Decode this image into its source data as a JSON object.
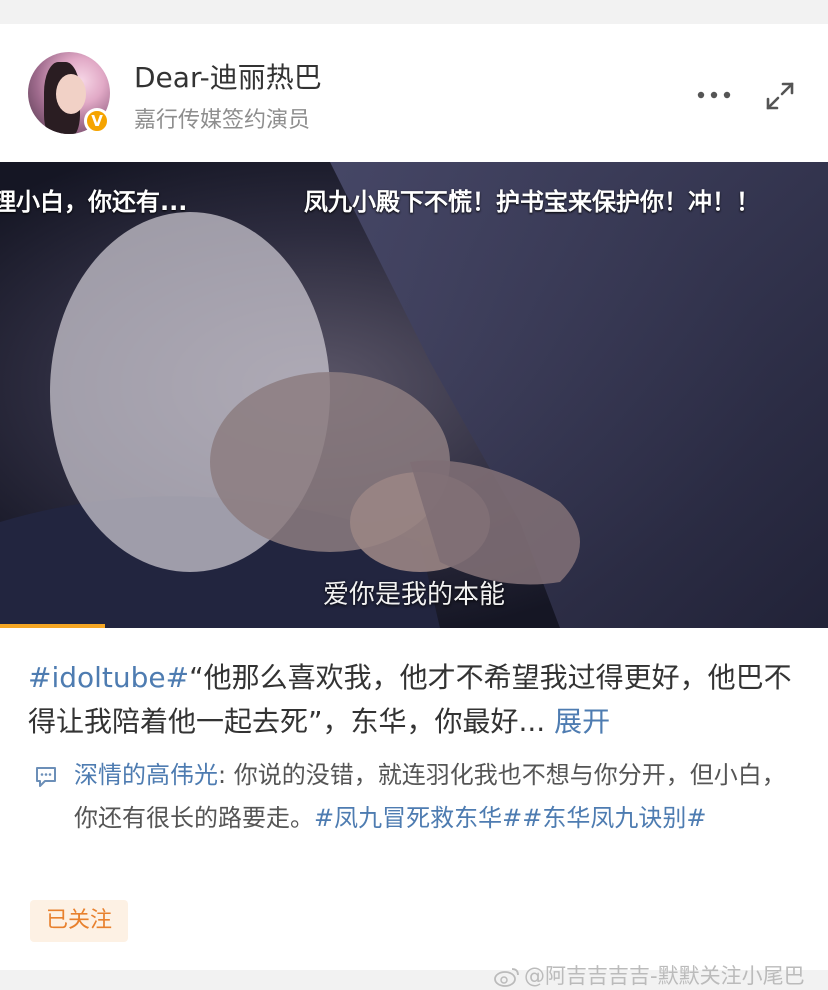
{
  "post": {
    "author_name": "Dear-迪丽热巴",
    "author_subtitle": "嘉行传媒签约演员",
    "verified_badge": "V",
    "video": {
      "danmu_left": "理小白，你还有...",
      "danmu_right": "凤九小殿下不慌！护书宝来保护你！冲！！",
      "subtitle": "爱你是我的本能",
      "progress_fraction": 0.127
    },
    "text_hashtag": "#idoltube#",
    "text_body": "“他那么喜欢我，他才不希望我过得更好，他巴不得让我陪着他一起去死”，东华，你最好...",
    "expand_label": "展开",
    "comment": {
      "commenter": "深情的高伟光",
      "separator": ": ",
      "text": "你说的没错，就连羽化我也不想与你分开，但小白，你还有很长的路要走。",
      "hashtags": "#凤九冒死救东华##东华凤九诀别#"
    },
    "follow_label": "已关注"
  },
  "watermark": "@阿吉吉吉吉-默默关注小尾巴",
  "icons": {
    "more": "more-horizontal-icon",
    "expand": "fullscreen-expand-icon",
    "comment": "comment-bubble-icon",
    "weibo": "weibo-logo-icon"
  },
  "colors": {
    "link": "#4e7cb1",
    "progress": "#f5a623",
    "follow_bg": "#fdf1e4",
    "follow_text": "#e8812e",
    "badge": "#f5a400"
  }
}
